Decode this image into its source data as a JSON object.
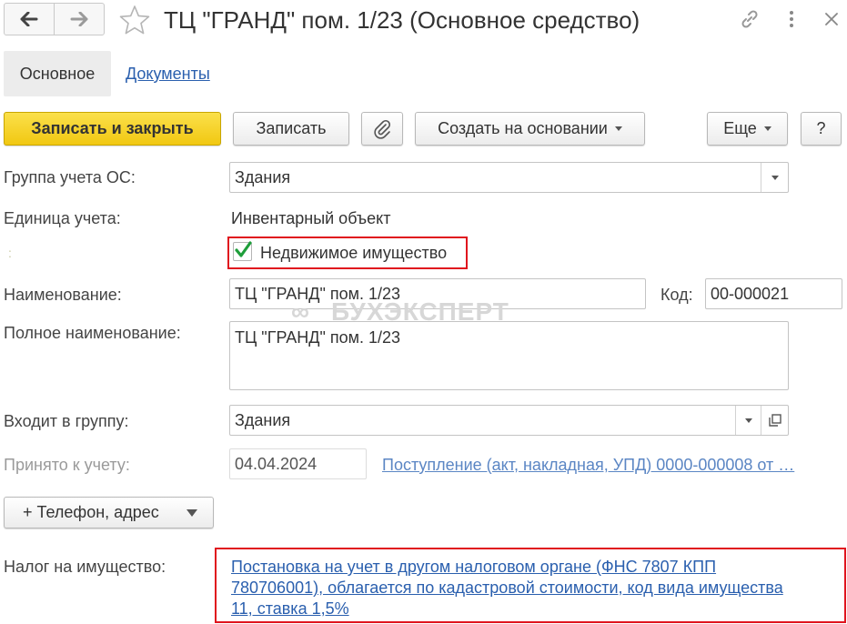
{
  "window": {
    "title": "ТЦ \"ГРАНД\" пом. 1/23 (Основное средство)"
  },
  "icons": {
    "back": "arrow-left-icon",
    "forward": "arrow-right-icon",
    "favorite": "star-icon",
    "link": "link-icon",
    "more": "more-vertical-icon",
    "close": "close-icon",
    "attach": "paperclip-icon",
    "open": "open-window-icon"
  },
  "tabs": [
    {
      "label": "Основное"
    },
    {
      "label": "Документы"
    }
  ],
  "toolbar": {
    "save_close": "Записать и закрыть",
    "save": "Записать",
    "create_based": "Создать на основании",
    "more": "Еще",
    "help": "?"
  },
  "form": {
    "group_label": "Группа учета ОС:",
    "group_value": "Здания",
    "unit_label": "Единица учета:",
    "unit_value": "Инвентарный объект",
    "colon_mark": ":",
    "realestate_label": "Недвижимое имущество",
    "realestate_checked": true,
    "name_label": "Наименование:",
    "name_value": "ТЦ \"ГРАНД\" пом. 1/23",
    "code_label": "Код:",
    "code_value": "00-000021",
    "fullname_label": "Полное наименование:",
    "fullname_value": "ТЦ \"ГРАНД\" пом. 1/23",
    "parent_label": "Входит в группу:",
    "parent_value": "Здания",
    "accepted_label": "Принято к учету:",
    "accepted_date": "04.04.2024",
    "accepted_doc": "Поступление (акт, накладная, УПД) 0000-000008 от …",
    "contacts_button": "+ Телефон, адрес",
    "tax_label": "Налог на имущество:",
    "tax_line1": "Постановка на учет в другом налоговом органе (ФНС 7807 КПП",
    "tax_line2": "780706001), облагается по кадастровой стоимости, код вида имущества",
    "tax_line3": "11, ставка 1,5%"
  },
  "watermark": {
    "text": "БУХЭКСПЕРТ"
  },
  "colors": {
    "primary_button": "#f1c812",
    "link": "#2a5fae",
    "highlight_frame": "#e0141e",
    "checkbox": "#1e9e3a"
  }
}
